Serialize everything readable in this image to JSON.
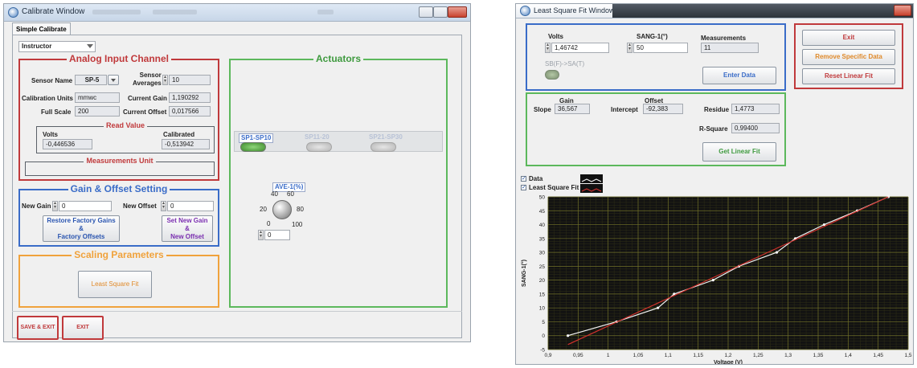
{
  "calibrate_window": {
    "title": "Calibrate Window",
    "tab": "Simple Calibrate",
    "role_select": "Instructor",
    "analog": {
      "title": "Analog Input Channel",
      "sensor_name_label": "Sensor Name",
      "sensor_name_value": "SP-5",
      "sensor_averages_label_1": "Sensor",
      "sensor_averages_label_2": "Averages",
      "sensor_averages_value": "10",
      "calibration_units_label": "Calibration Units",
      "calibration_units_value": "mmwc",
      "current_gain_label": "Current Gain",
      "current_gain_value": "1,190292",
      "full_scale_label": "Full Scale",
      "full_scale_value": "200",
      "current_offset_label": "Current Offset",
      "current_offset_value": "0,017566",
      "read_value_title": "Read Value",
      "volts_label": "Volts",
      "volts_value": "-0,446536",
      "calibrated_label": "Calibrated",
      "calibrated_value": "-0,513942",
      "measurements_unit_title": "Measurements Unit",
      "measurements_unit_value": ""
    },
    "gain_offset": {
      "title": "Gain & Offset Setting",
      "new_gain_label": "New Gain",
      "new_gain_value": "0",
      "new_offset_label": "New Offset",
      "new_offset_value": "0",
      "restore_btn_1": "Restore  Factory Gains",
      "restore_btn_2": "&",
      "restore_btn_3": "Factory Offsets",
      "set_btn_1": "Set  New Gain",
      "set_btn_2": "&",
      "set_btn_3": "New Offset"
    },
    "scaling": {
      "title": "Scaling Parameters",
      "lsf_button": "Least Square Fit"
    },
    "actuators": {
      "title": "Actuators",
      "sp_group_1": "SP1-SP10",
      "sp_group_2": "SP11-20",
      "sp_group_3": "SP21-SP30",
      "knob_label": "AVE-1(%)",
      "knob_ticks": [
        "0",
        "20",
        "40",
        "60",
        "80",
        "100"
      ],
      "knob_value": "0"
    },
    "save_exit": "SAVE & EXIT",
    "exit": "EXIT"
  },
  "lsf_window": {
    "title": "Least Square Fit Window",
    "volts_label": "Volts",
    "volts_value": "1,46742",
    "sang_label": "SANG-1(°)",
    "sang_value": "50",
    "measurements_label": "Measurements",
    "measurements_value": "11",
    "led_label": "SB(F)->SA(T)",
    "enter_data": "Enter Data",
    "exit": "Exit",
    "remove_specific": "Remove Specific Data",
    "reset_linear": "Reset Linear Fit",
    "gain_label": "Gain",
    "slope_label": "Slope",
    "slope_value": "36,567",
    "offset_label": "Offset",
    "intercept_label": "Intercept",
    "intercept_value": "-92,383",
    "residue_label": "Residue",
    "residue_value": "1,4773",
    "rsquare_label": "R-Square",
    "rsquare_value": "0,99400",
    "get_linear_fit": "Get Linear Fit",
    "legend_data": "Data",
    "legend_lsf": "Least Square Fit"
  },
  "chart_data": {
    "type": "line",
    "xlabel": "Voltage (V)",
    "ylabel": "SANG-1(°)",
    "xlim": [
      0.9,
      1.5
    ],
    "ylim": [
      -5,
      50
    ],
    "xticks": [
      "0,9",
      "0,95",
      "1",
      "1,05",
      "1,1",
      "1,15",
      "1,2",
      "1,25",
      "1,3",
      "1,35",
      "1,4",
      "1,45",
      "1,5"
    ],
    "yticks": [
      "-5",
      "0",
      "5",
      "10",
      "15",
      "20",
      "25",
      "30",
      "35",
      "40",
      "45",
      "50"
    ],
    "grid": true,
    "series": [
      {
        "name": "Data",
        "color": "#f2f2f2",
        "x": [
          0.933,
          1.014,
          1.083,
          1.11,
          1.175,
          1.218,
          1.281,
          1.312,
          1.36,
          1.415,
          1.467
        ],
        "y": [
          0,
          5,
          10,
          15,
          20,
          25,
          30,
          35,
          40,
          45,
          50
        ]
      },
      {
        "name": "Least Square Fit",
        "color": "#d0312d",
        "x": [
          0.933,
          1.467
        ],
        "y": [
          -3.2,
          50.0
        ]
      }
    ]
  },
  "colors": {
    "analog_frame": "#c0393b",
    "actuator_frame": "#5cb85c",
    "gain_frame": "#3a6cc8",
    "scaling_frame": "#f0a23c",
    "save_frame": "#c0393b",
    "title_red": "#c0393b",
    "plot_bg": "#121212",
    "grid": "#6f6f28"
  }
}
